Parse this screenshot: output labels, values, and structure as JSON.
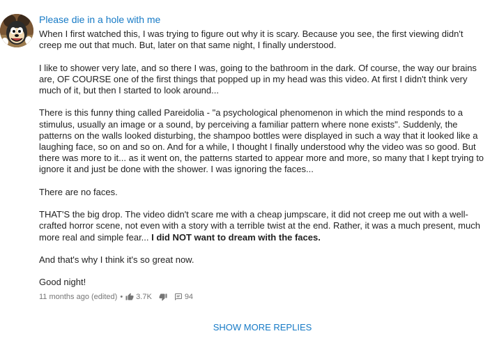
{
  "comment": {
    "author": "Please die in a hole with me",
    "paragraphs": [
      "When I first watched this, I was trying to figure out why it is scary. Because you see, the first viewing didn't creep me out that much. But, later on that same night, I finally understood.",
      "I like to shower very late, and so there I was, going to the bathroom in the dark. Of course, the way our brains are, OF COURSE one of the first things that popped up in my head was this video. At first I didn't think very much of it, but then I started to look around...",
      "There is this funny thing called Pareidolia - \"a psychological phenomenon in which the mind responds to a stimulus, usually an image or a sound, by perceiving a familiar pattern where none exists\". Suddenly, the patterns on the walls looked disturbing, the shampoo bottles were displayed in such a way that it looked like a laughing face, so on and so on. And for a while, I thought I finally understood why the video was so good. But there was more to it... as it went on, the patterns started to appear more and more, so many that I kept trying to ignore it and just be done with the shower. I was ignoring the faces...",
      "There are no faces."
    ],
    "paragraph5_normal": "THAT'S the big drop. The video didn't scare me with a cheap jumpscare, it did not creep me out with a well-crafted horror scene, not even with a story with a terrible twist at the end. Rather, it was a much present, much more real and simple fear... ",
    "paragraph5_bold": "I did NOT want to dream with the faces.",
    "paragraph6": "And that's why I think it's so great now.",
    "paragraph7": "Good night!",
    "timestamp": "11 months ago (edited)",
    "separator": "•",
    "likes": "3.7K",
    "replies": "94",
    "icons": {
      "like": "thumbs-up-icon",
      "dislike": "thumbs-down-icon",
      "reply": "reply-icon"
    }
  },
  "show_more_label": "SHOW MORE REPLIES",
  "colors": {
    "link": "#167ac6",
    "text": "#222222",
    "meta": "#767676"
  }
}
